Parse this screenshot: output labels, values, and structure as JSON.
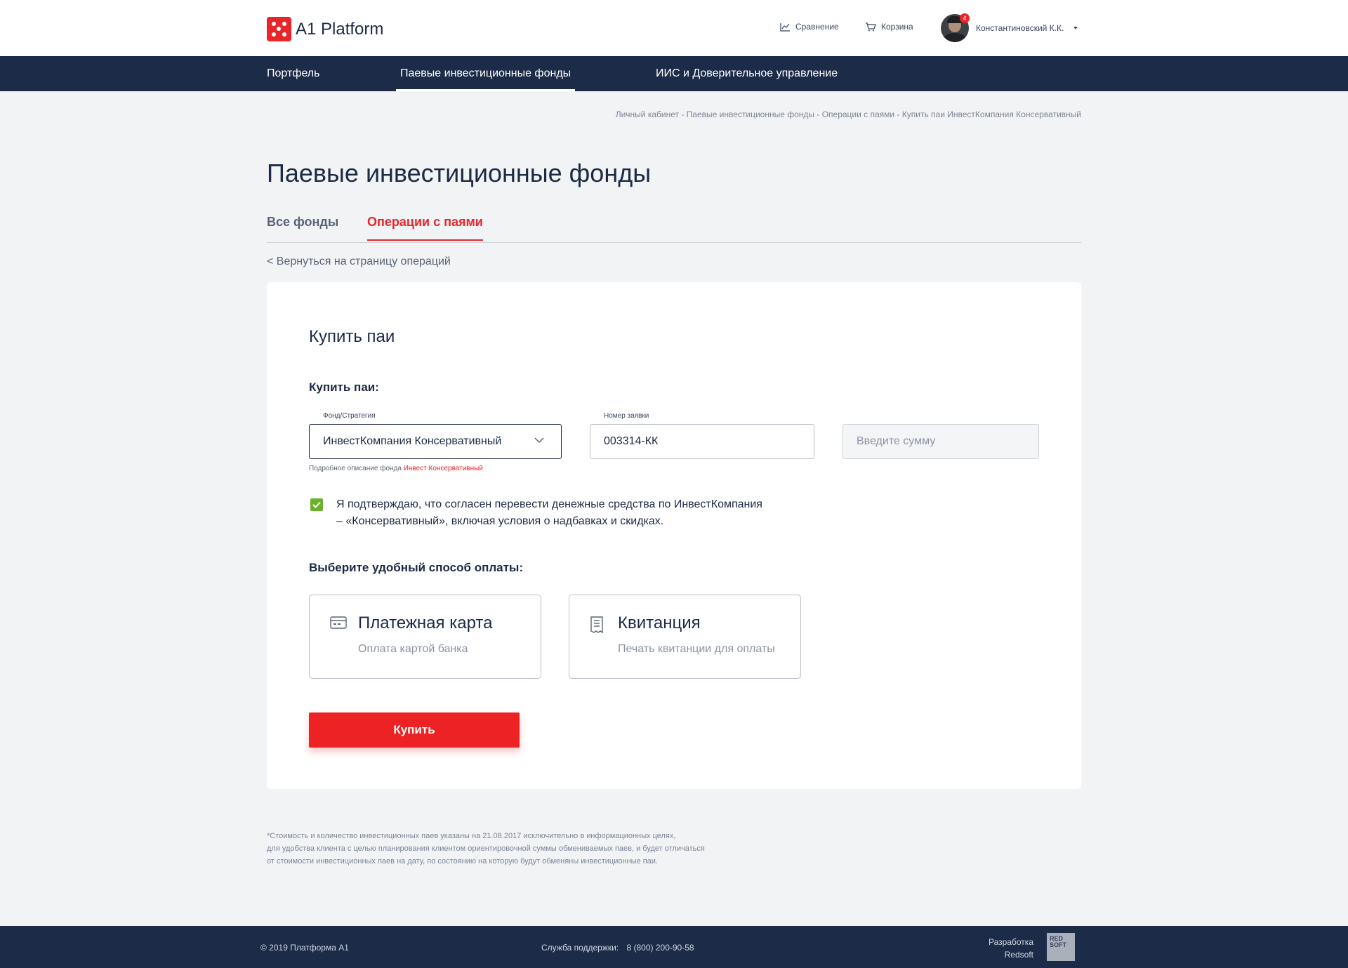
{
  "header": {
    "logo_text": "A1 Platform",
    "compare_label": "Сравнение",
    "cart_label": "Корзина",
    "user_name": "Константиновский К.К.",
    "notifications_count": "4"
  },
  "nav": {
    "items": [
      {
        "label": "Портфель",
        "active": false
      },
      {
        "label": "Паевые инвестиционные фонды",
        "active": true
      },
      {
        "label": "ИИС и Доверительное управление",
        "active": false
      }
    ]
  },
  "breadcrumb": "Личный кабинет - Паевые инвестиционные фонды - Операции с паями - Купить паи ИнвестКомпания Консервативный",
  "page_title": "Паевые инвестиционные фонды",
  "tabs": [
    {
      "label": "Все фонды",
      "active": false
    },
    {
      "label": "Операции с паями",
      "active": true
    }
  ],
  "back_link": "< Вернуться на страницу операций",
  "form": {
    "card_title": "Купить паи",
    "section_label": "Купить паи:",
    "fund": {
      "label": "Фонд/Стратегия",
      "value": "ИнвестКомпания Консервативный"
    },
    "order": {
      "label": "Номер заявки",
      "value": "003314-КК"
    },
    "amount": {
      "placeholder": "Введите сумму"
    },
    "hint_text": "Подробное описание фонда",
    "hint_link": "Инвест Консервативный",
    "consent_checked": true,
    "consent_line1": "Я подтверждаю, что согласен перевести денежные средства по ИнвестКомпания",
    "consent_line2": "– «Консервативный», включая условия о надбавках и скидках.",
    "payment_label": "Выберите удобный способ оплаты:",
    "payment_methods": [
      {
        "title": "Платежная карта",
        "subtitle": "Оплата картой банка",
        "icon": "credit-card-icon"
      },
      {
        "title": "Квитанция",
        "subtitle": "Печать квитанции для оплаты",
        "icon": "receipt-icon"
      }
    ],
    "submit_label": "Купить"
  },
  "disclaimer": {
    "line1": "*Стоимость и количество инвестиционных паев указаны на 21.08.2017 исключительно в информационных целях,",
    "line2": "для удобства клиента с целью планирования клиентом ориентировочной суммы обмениваемых паев, и будет отличаться",
    "line3": "от стоимости инвестиционных паев на дату, по состоянию на которую будут обменяны инвестиционные паи."
  },
  "footer": {
    "copyright": "© 2019  Платформа А1",
    "support_label": "Служба поддержки:",
    "support_phone": "8 (800) 200-90-58",
    "dev_line1": "Разработка",
    "dev_line2": "Redsoft",
    "dev_logo_line1": "RED",
    "dev_logo_line2": "SOFT"
  },
  "colors": {
    "accent": "#e8262a",
    "navy": "#1c2b47",
    "check": "#6ab12b"
  }
}
